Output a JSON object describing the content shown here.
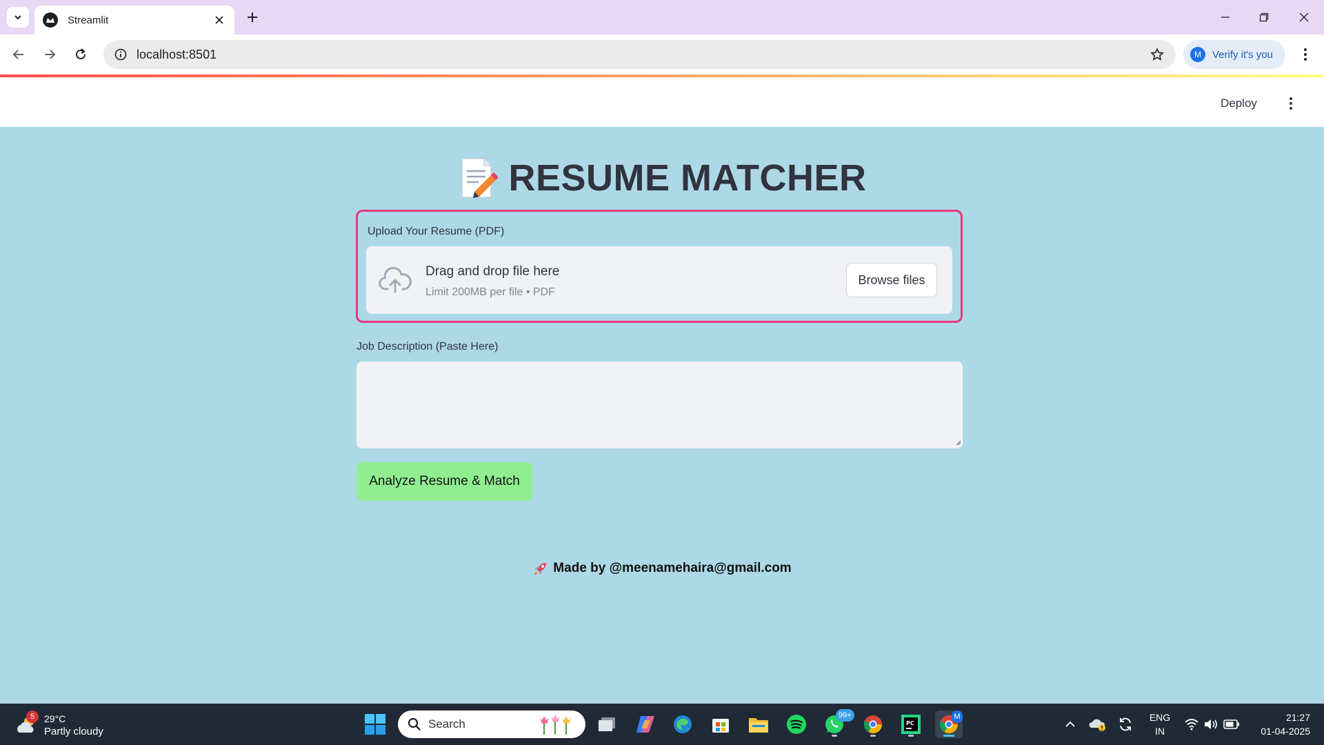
{
  "browser": {
    "tab_title": "Streamlit",
    "url": "localhost:8501",
    "verify_label": "Verify it's you",
    "verify_avatar": "M"
  },
  "streamlit_header": {
    "deploy_label": "Deploy"
  },
  "app": {
    "title": "RESUME MATCHER",
    "title_icon": "memo-icon",
    "upload": {
      "label": "Upload Your Resume (PDF)",
      "drop_text": "Drag and drop file here",
      "limit_text": "Limit 200MB per file • PDF",
      "browse_label": "Browse files"
    },
    "job_description": {
      "label": "Job Description (Paste Here)",
      "value": ""
    },
    "analyze_label": "Analyze Resume & Match",
    "footer": "Made by @meenamehaira@gmail.com",
    "colors": {
      "background": "#add8e6",
      "upload_border": "#e6397a",
      "analyze_button": "#90ee90",
      "title_text": "#31333f"
    }
  },
  "taskbar": {
    "weather_temp": "29°C",
    "weather_desc": "Partly cloudy",
    "weather_badge": "5",
    "search_placeholder": "Search",
    "whatsapp_badge": "99+",
    "chrome_badge": "M",
    "lang_top": "ENG",
    "lang_bottom": "IN",
    "time": "21:27",
    "date": "01-04-2025"
  }
}
